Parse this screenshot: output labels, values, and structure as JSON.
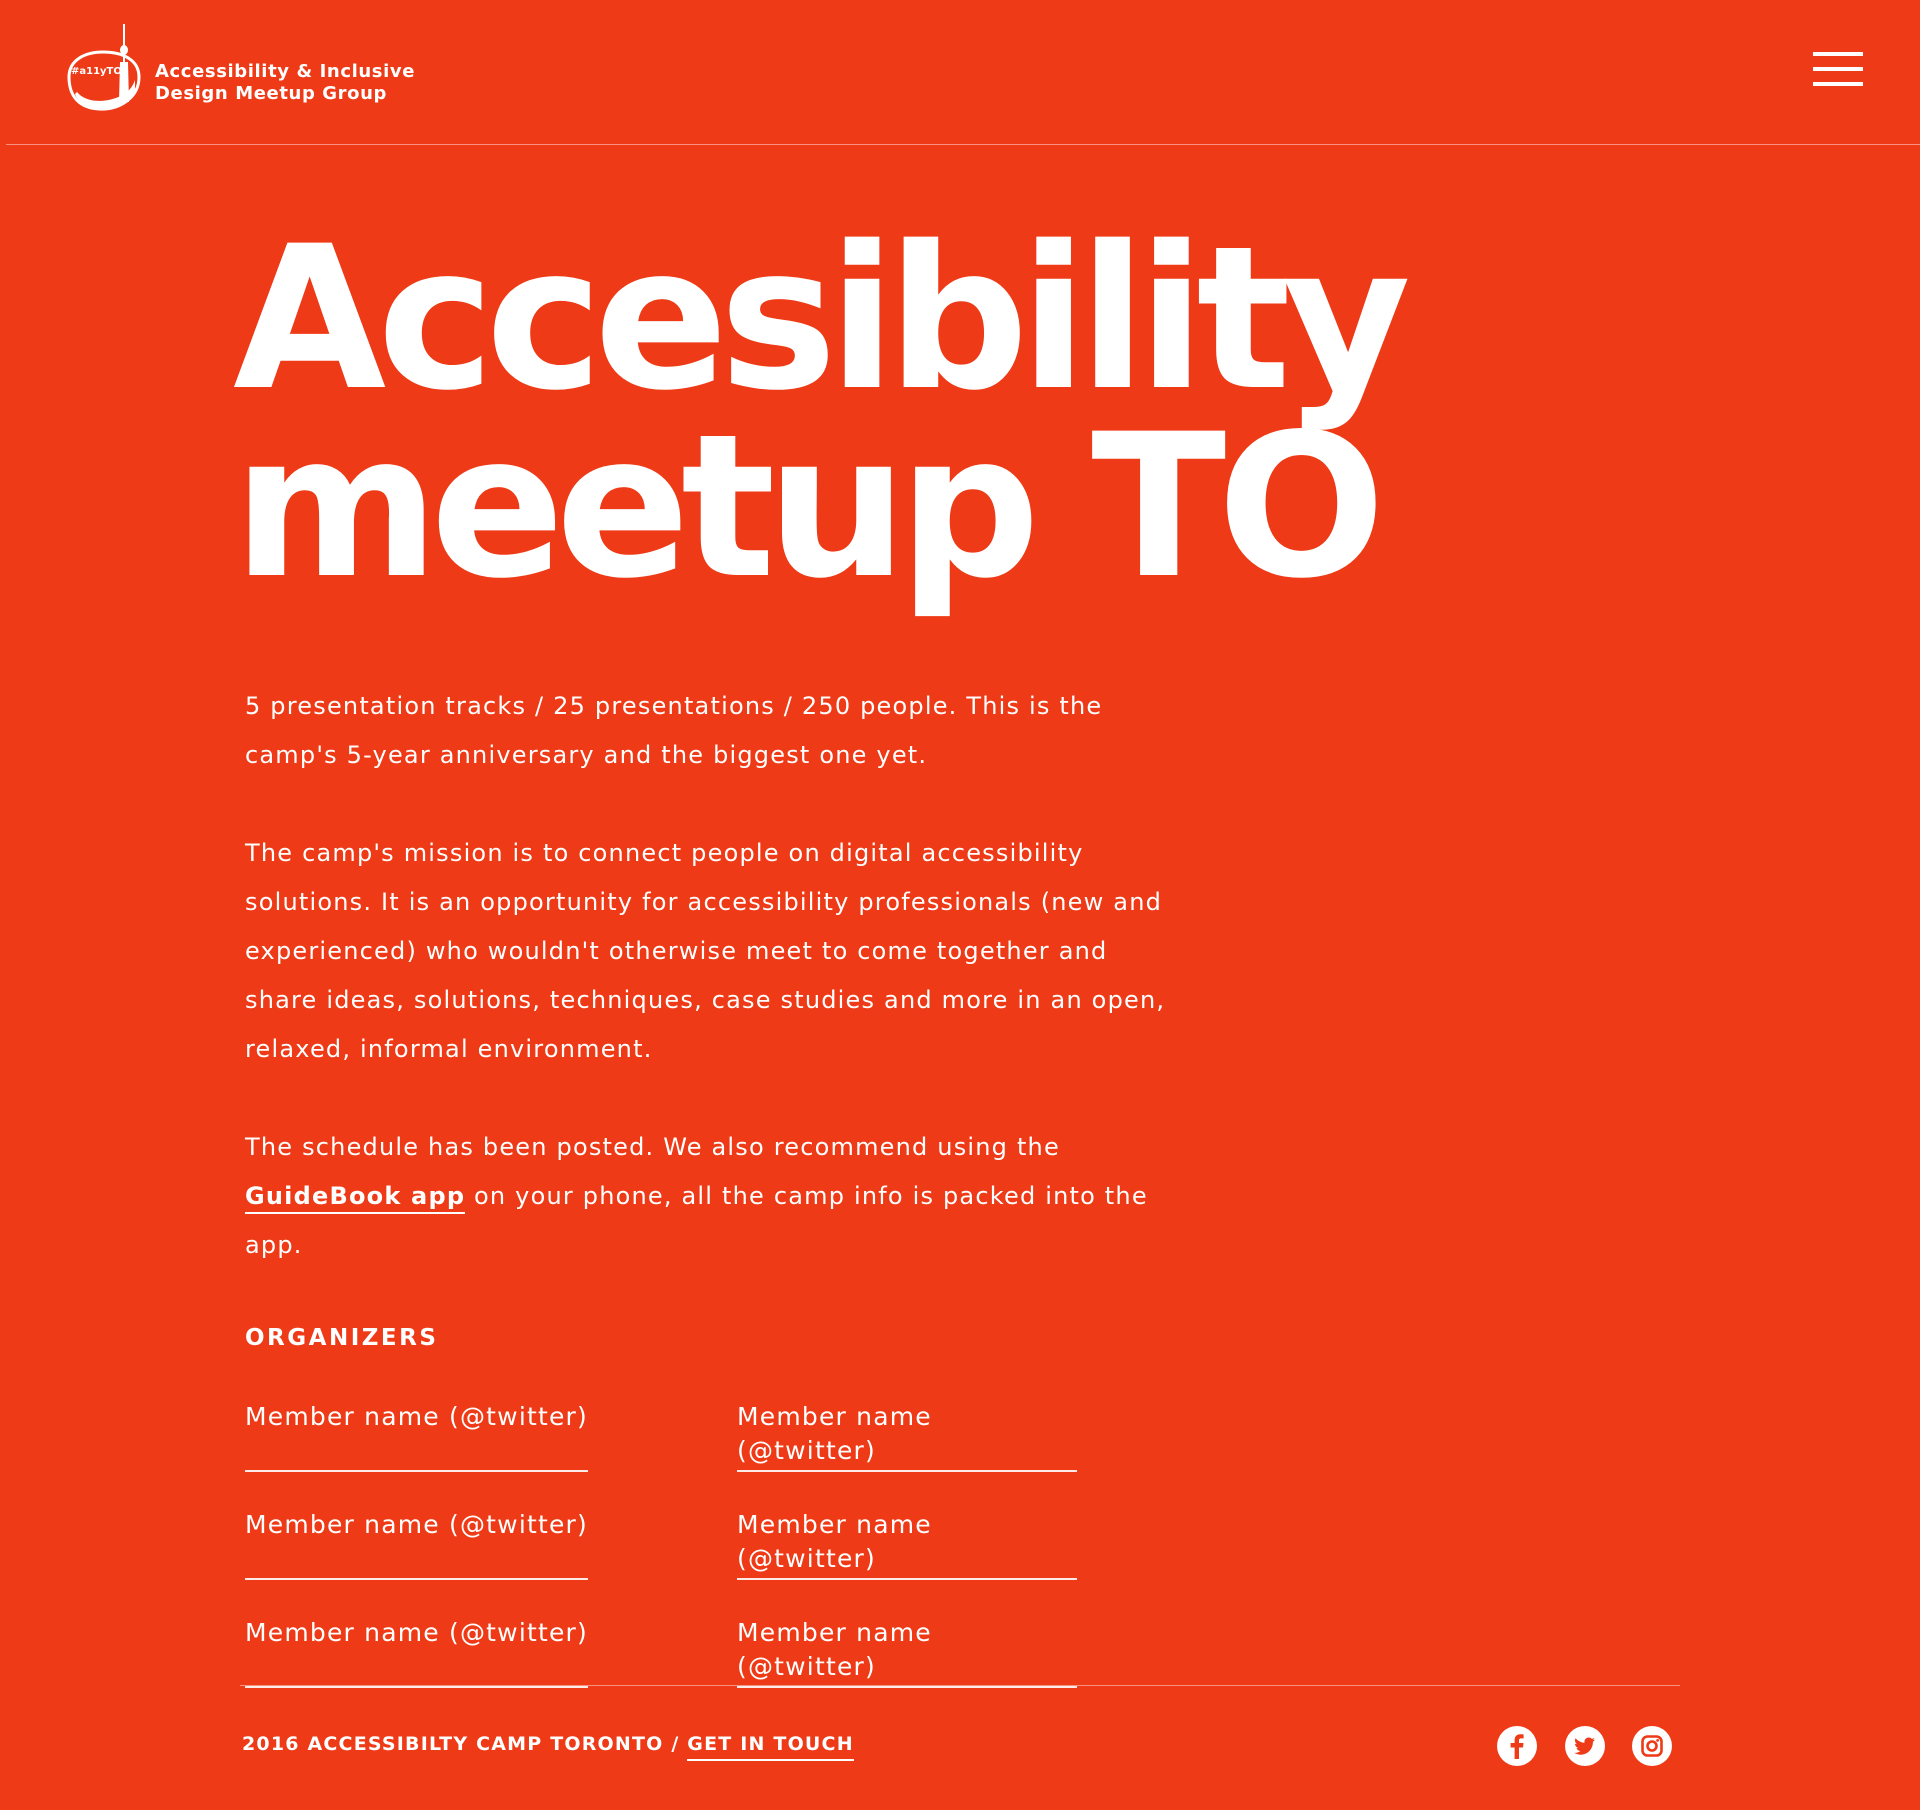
{
  "header": {
    "logo_text": "#a11yTO",
    "brand_line1": "Accessibility & Inclusive",
    "brand_line2": "Design Meetup Group",
    "menu_icon": "hamburger-menu-icon"
  },
  "hero": {
    "title_line1": "Accesibility",
    "title_line2": "meetup TO"
  },
  "content": {
    "paragraph1": "5 presentation tracks / 25 presentations / 250 people. This is the camp's 5-year anniversary and the biggest one yet.",
    "paragraph2": "The camp's mission is to connect people on digital accessibility solutions. It is an opportunity for accessibility professionals (new and experienced) who wouldn't otherwise meet to come together and share ideas, solutions, techniques, case studies and more in an open, relaxed, informal environment.",
    "paragraph3_before": "The schedule has been posted. We also recommend using the ",
    "paragraph3_link": "GuideBook app",
    "paragraph3_after": " on your phone, all the camp info is packed into the app."
  },
  "organizers": {
    "heading": "ORGANIZERS",
    "members": [
      "Member name (@twitter)",
      "Member name (@twitter)",
      "Member name (@twitter)",
      "Member name (@twitter)",
      "Member name (@twitter)",
      "Member name (@twitter)"
    ]
  },
  "footer": {
    "copyright": "2016 ACCESSIBILTY CAMP TORONTO / ",
    "contact_link": "GET IN TOUCH",
    "social_icons": [
      "facebook-icon",
      "twitter-icon",
      "instagram-icon"
    ]
  },
  "colors": {
    "background": "#ee3a16",
    "text": "#ffffff"
  }
}
